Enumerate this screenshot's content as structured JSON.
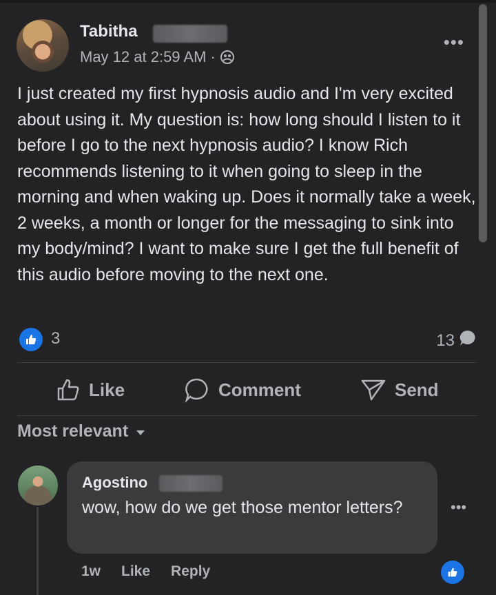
{
  "post": {
    "author_name": "Tabitha",
    "timestamp": "May 12 at 2:59 AM",
    "meta_separator": "·",
    "audience_icon": "group-icon",
    "more_label": "•••",
    "body": "I just created my first hypnosis audio and I'm very excited about using it. My question is: how long should I listen to it before I go to the next hypnosis audio? I know Rich recommends listening to it when going to sleep in the morning and when waking up. Does it normally take a week, 2 weeks, a month or longer for the messaging to sink into my body/mind? I want to make sure I get the full benefit of this audio before moving to the next one.",
    "reaction_count": "3",
    "comment_count": "13"
  },
  "actions": {
    "like": "Like",
    "comment": "Comment",
    "send": "Send"
  },
  "comments_sort": {
    "label": "Most relevant"
  },
  "comment": {
    "author_name": "Agostino",
    "text": "wow, how do we get those mentor letters?",
    "time": "1w",
    "like": "Like",
    "reply": "Reply",
    "more_label": "•••"
  },
  "colors": {
    "background": "#232325",
    "accent": "#1b74e4",
    "bubble": "#3a3b3c",
    "secondary_text": "#b0b3b8"
  }
}
